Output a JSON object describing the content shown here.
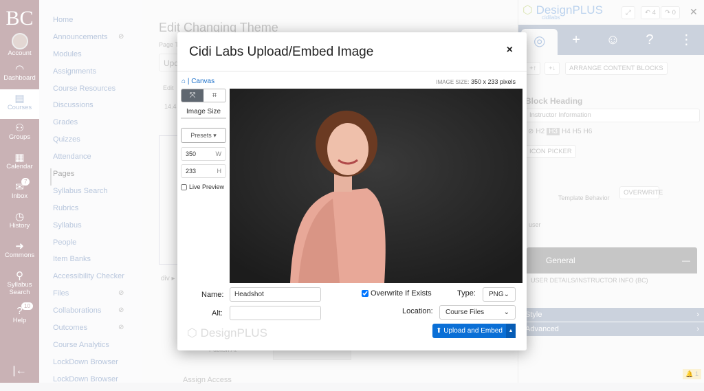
{
  "global_nav": {
    "logo": "BC",
    "items": [
      {
        "label": "Account",
        "icon": "avatar"
      },
      {
        "label": "Dashboard",
        "icon": "gauge-icon"
      },
      {
        "label": "Courses",
        "icon": "book-icon",
        "active": true
      },
      {
        "label": "Groups",
        "icon": "groups-icon"
      },
      {
        "label": "Calendar",
        "icon": "calendar-icon"
      },
      {
        "label": "Inbox",
        "icon": "inbox-icon",
        "badge": "7"
      },
      {
        "label": "History",
        "icon": "clock-icon"
      },
      {
        "label": "Commons",
        "icon": "commons-icon"
      },
      {
        "label": "Syllabus Search",
        "icon": "search-icon"
      },
      {
        "label": "Help",
        "icon": "help-icon",
        "badge": "10"
      }
    ]
  },
  "course_nav": [
    "Home",
    "Announcements",
    "Modules",
    "Assignments",
    "Course Resources",
    "Discussions",
    "Grades",
    "Quizzes",
    "Attendance",
    "Pages",
    "Syllabus Search",
    "Rubrics",
    "Syllabus",
    "People",
    "Item Banks",
    "Accessibility Checker",
    "Files",
    "Collaborations",
    "Outcomes",
    "Course Analytics",
    "LockDown Browser",
    "LockDown Browser"
  ],
  "main": {
    "title": "Edit Changing Theme",
    "page_title_label": "Page T",
    "title_value": "Upd",
    "edit": "Edit",
    "size": "14.4",
    "path": "div ▸",
    "publish_at": "Publish At",
    "assign_access": "Assign Access"
  },
  "modal": {
    "title": "Cidi Labs Upload/Embed Image",
    "close": "×",
    "breadcrumb": "Canvas",
    "image_size_label": "IMAGE SIZE:",
    "image_size_value": "350 x 233 pixels",
    "image_size_heading": "Image Size",
    "presets": "Presets ▾",
    "width": "350",
    "width_unit": "W",
    "height": "233",
    "height_unit": "H",
    "live_preview": "Live Preview",
    "live_preview_checked": false,
    "name_label": "Name:",
    "name_value": "Headshot",
    "alt_label": "Alt:",
    "alt_value": "",
    "overwrite_label": "Overwrite If Exists",
    "overwrite_checked": true,
    "type_label": "Type:",
    "type_value": "PNG",
    "location_label": "Location:",
    "location_value": "Course Files",
    "upload_button": "Upload and Embed",
    "watermark": "DesignPLUS",
    "accent": "#0a6fd6"
  },
  "designplus": {
    "brand": "DesignPLUS",
    "sub": "cidilabs",
    "undo": "4",
    "redo": "0",
    "arrange": "ARRANGE CONTENT BLOCKS",
    "block_heading": "Block Heading",
    "heading_value": "Instructor Information",
    "levels": [
      "H2",
      "H3",
      "H4",
      "H5",
      "H6"
    ],
    "selected_level": "H3",
    "icon_picker": "ICON PICKER",
    "template_behavior": "Template Behavior",
    "overwrite": "OVERWRITE",
    "user": "user",
    "general": "General",
    "template_item": "USER DETAILS/INSTRUCTOR INFO (BC)",
    "style": "Style",
    "advanced": "Advanced",
    "notifications": "1"
  }
}
